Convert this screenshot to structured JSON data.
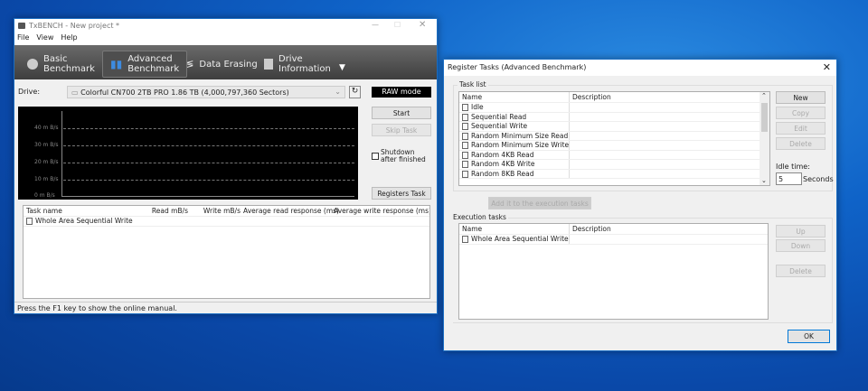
{
  "main": {
    "title": "TxBENCH - New project *",
    "menu": [
      "File",
      "View",
      "Help"
    ],
    "tabs": [
      {
        "label1": "Basic",
        "label2": "Benchmark"
      },
      {
        "label1": "Advanced",
        "label2": "Benchmark"
      },
      {
        "label1": "Data Erasing",
        "label2": ""
      },
      {
        "label1": "Drive",
        "label2": "Information"
      }
    ],
    "drive_label": "Drive:",
    "drive_value": "Colorful CN700 2TB PRO  1.86 TB (4,000,797,360 Sectors)",
    "raw_mode": "RAW mode",
    "start": "Start",
    "skip": "Skip Task",
    "shutdown": "Shutdown after finished",
    "registers": "Registers Task",
    "y_ticks": [
      "40 m B/s",
      "30 m B/s",
      "20 m B/s",
      "10 m B/s",
      "0 m B/s"
    ],
    "columns": [
      "Task name",
      "Read mB/s",
      "Write mB/s",
      "Average read response (ms)",
      "Average write response (ms)"
    ],
    "rows": [
      "Whole Area Sequential Write"
    ],
    "status": "Press the F1 key to show the online manual."
  },
  "dialog": {
    "title": "Register Tasks (Advanced Benchmark)",
    "task_list_label": "Task list",
    "col_name": "Name",
    "col_desc": "Description",
    "tasks": [
      "Idle",
      "Sequential Read",
      "Sequential Write",
      "Random Minimum Size Read",
      "Random Minimum Size Write",
      "Random 4KB Read",
      "Random 4KB Write",
      "Random 8KB Read"
    ],
    "new": "New",
    "copy": "Copy",
    "edit": "Edit",
    "delete": "Delete",
    "idle_label": "Idle time:",
    "idle_value": "5",
    "seconds": "Seconds",
    "add": "Add it to the execution tasks",
    "exec_label": "Execution tasks",
    "exec_tasks": [
      "Whole Area Sequential Write"
    ],
    "up": "Up",
    "down": "Down",
    "delete2": "Delete",
    "ok": "OK"
  }
}
